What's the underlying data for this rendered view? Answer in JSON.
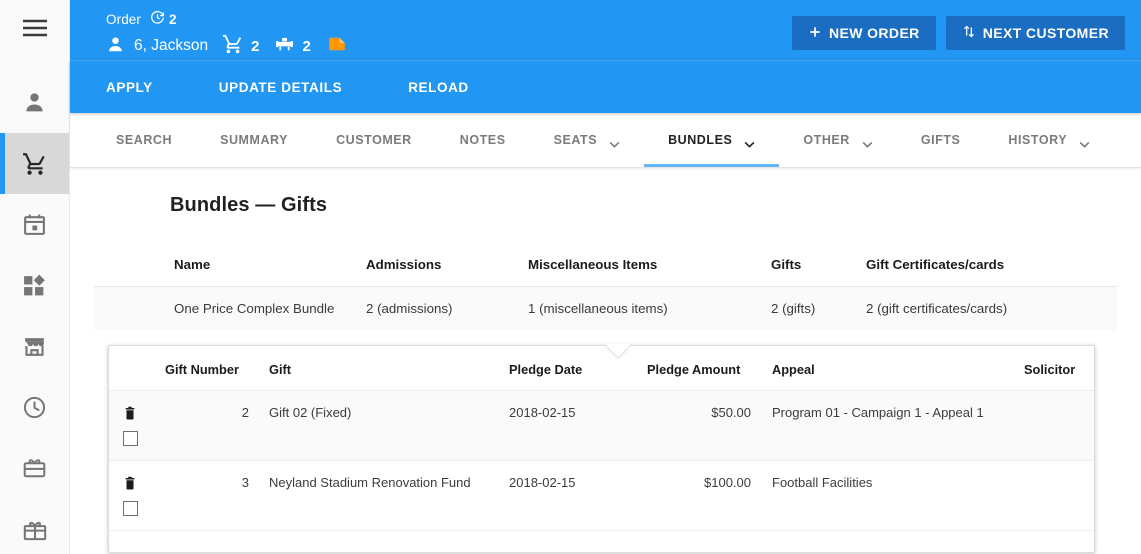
{
  "sidebar": {
    "items": [
      {
        "name": "menu-icon",
        "label": "Menu",
        "active": false
      },
      {
        "name": "person-icon",
        "label": "Customers",
        "active": false
      },
      {
        "name": "cart-icon",
        "label": "Orders",
        "active": true
      },
      {
        "name": "calendar-icon",
        "label": "Calendar",
        "active": false
      },
      {
        "name": "dashboard-icon",
        "label": "Dashboard",
        "active": false
      },
      {
        "name": "store-icon",
        "label": "Store",
        "active": false
      },
      {
        "name": "clock-icon",
        "label": "History",
        "active": false
      },
      {
        "name": "giftcard-icon",
        "label": "Gift Cards",
        "active": false
      },
      {
        "name": "gift-icon",
        "label": "Gifts",
        "active": false
      }
    ],
    "active_accent": "#2196f3"
  },
  "order_header": {
    "title": "Order",
    "timer_count": "2",
    "customer": "6, Jackson",
    "cart_count": "2",
    "seat_count": "2",
    "note_icon_color": "#ff9800",
    "buttons": [
      {
        "icon": "plus-icon",
        "label": "NEW ORDER"
      },
      {
        "icon": "swap-vert-icon",
        "label": "NEXT CUSTOMER"
      }
    ]
  },
  "action_bar": {
    "items": [
      {
        "label": "APPLY"
      },
      {
        "label": "UPDATE DETAILS"
      },
      {
        "label": "RELOAD"
      }
    ]
  },
  "tabs": [
    {
      "label": "SEARCH",
      "caret": false,
      "active": false
    },
    {
      "label": "SUMMARY",
      "caret": false,
      "active": false
    },
    {
      "label": "CUSTOMER",
      "caret": false,
      "active": false
    },
    {
      "label": "NOTES",
      "caret": false,
      "active": false
    },
    {
      "label": "SEATS",
      "caret": true,
      "active": false
    },
    {
      "label": "BUNDLES",
      "caret": true,
      "active": true
    },
    {
      "label": "OTHER",
      "caret": true,
      "active": false
    },
    {
      "label": "GIFTS",
      "caret": false,
      "active": false
    },
    {
      "label": "HISTORY",
      "caret": true,
      "active": false
    }
  ],
  "page": {
    "title": "Bundles — Gifts"
  },
  "bundle_table": {
    "headers": [
      "Name",
      "Admissions",
      "Miscellaneous Items",
      "Gifts",
      "Gift Certificates/cards"
    ],
    "rows": [
      {
        "name": "One Price Complex Bundle",
        "admissions": "2 (admissions)",
        "miscellaneous": "1 (miscellaneous items)",
        "gifts": "2 (gifts)",
        "certificates": "2 (gift certificates/cards)"
      }
    ]
  },
  "gift_table": {
    "headers": {
      "actions": "",
      "gift_number": "Gift Number",
      "gift": "Gift",
      "pledge_date": "Pledge Date",
      "pledge_amount": "Pledge Amount",
      "appeal": "Appeal",
      "solicitor": "Solicitor"
    },
    "rows": [
      {
        "gift_number": "2",
        "gift": "Gift 02 (Fixed)",
        "pledge_date": "2018-02-15",
        "pledge_amount": "$50.00",
        "appeal": "Program 01 - Campaign 1 - Appeal 1",
        "solicitor": ""
      },
      {
        "gift_number": "3",
        "gift": "Neyland Stadium Renovation Fund",
        "pledge_date": "2018-02-15",
        "pledge_amount": "$100.00",
        "appeal": "Football Facilities",
        "solicitor": ""
      }
    ]
  }
}
